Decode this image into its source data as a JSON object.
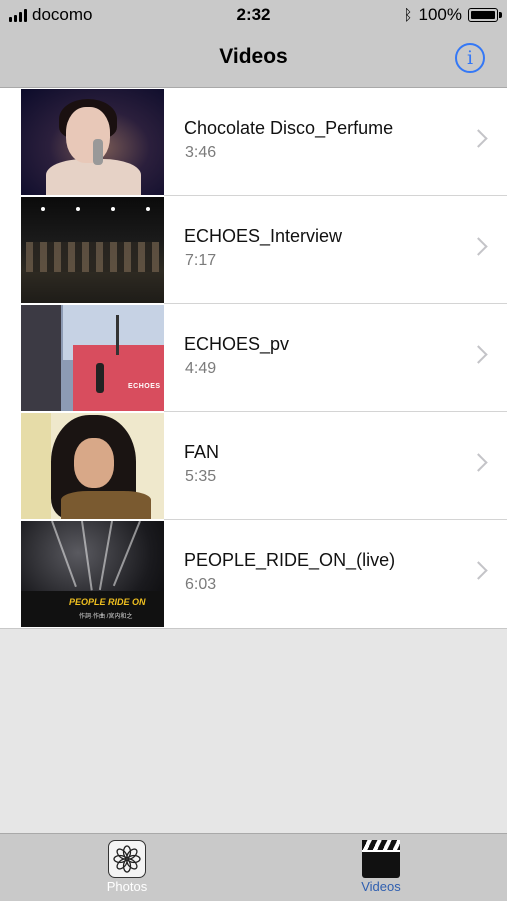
{
  "status_bar": {
    "carrier": "docomo",
    "time": "2:32",
    "battery": "100%"
  },
  "nav": {
    "title": "Videos"
  },
  "videos": [
    {
      "title": "Chocolate Disco_Perfume",
      "duration": "3:46"
    },
    {
      "title": "ECHOES_Interview",
      "duration": "7:17"
    },
    {
      "title": "ECHOES_pv",
      "duration": "4:49"
    },
    {
      "title": "FAN",
      "duration": "5:35"
    },
    {
      "title": "PEOPLE_RIDE_ON_(live)",
      "duration": "6:03"
    }
  ],
  "thumbnail_captions": {
    "echoes_pv": "ECHOES",
    "people_ride_on": "PEOPLE RIDE ON",
    "people_ride_on_credit": "作詞·作曲 /宮内和之"
  },
  "tabs": [
    {
      "label": "Photos",
      "icon": "photos-icon",
      "selected": false
    },
    {
      "label": "Videos",
      "icon": "clapperboard-icon",
      "selected": true
    }
  ],
  "colors": {
    "accent": "#3478f6",
    "selected_tab": "#2f5fb0",
    "bar_background": "#c9c9c9"
  }
}
